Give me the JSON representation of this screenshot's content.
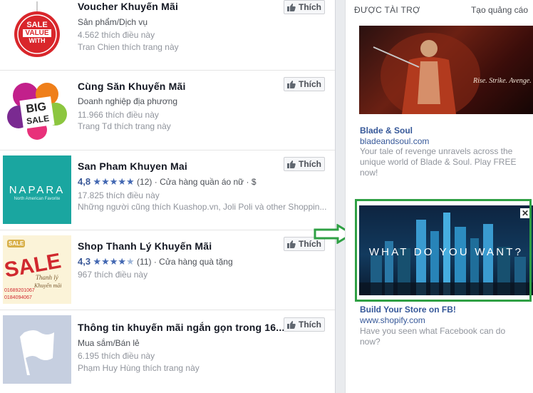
{
  "pages": [
    {
      "name": "Voucher Khuyến Mãi",
      "category": "Sản phẩm/Dịch vụ",
      "likes": "4.562 thích điều này",
      "friends": "Tran Chien thích trang này",
      "like_label": "Thích",
      "thumb_text": [
        "SALE",
        "VALUE",
        "WITH"
      ]
    },
    {
      "name": "Cùng Săn Khuyến Mãi",
      "category": "Doanh nghiệp địa phương",
      "likes": "11.966 thích điều này",
      "friends": "Trang Td thích trang này",
      "like_label": "Thích",
      "thumb_text": [
        "BIG",
        "SALE"
      ]
    },
    {
      "name": "San Pham Khuyen Mai",
      "rating": "4,8",
      "stars": "★★★★★",
      "reviews": "(12)",
      "category": "· Cửa hàng quần áo nữ · $",
      "likes": "17.825 thích điều này",
      "friends": "Những người cũng thích Kuashop.vn, Joli Poli và other Shoppin...",
      "like_label": "Thích",
      "thumb_text": [
        "NAPARA",
        "North American Favorite"
      ]
    },
    {
      "name": "Shop Thanh Lý Khuyến Mãi",
      "rating": "4,3",
      "stars": "★★★★",
      "stars_half": "★",
      "reviews": "(11)",
      "category": "· Cửa hàng quà tặng",
      "likes": "967 thích điều này",
      "like_label": "Thích",
      "thumb_text": [
        "SALE",
        "SALE",
        "Thanh lý",
        "Khuyến mãi",
        "01689201067",
        "0184094067"
      ]
    },
    {
      "name": "Thông tin khuyến mãi ngắn gọn trong 16...",
      "category": "Mua sắm/Bán lẻ",
      "likes": "6.195 thích điều này",
      "friends": "Phạm Huy Hùng thích trang này",
      "like_label": "Thích"
    }
  ],
  "sidebar": {
    "sponsored": "ĐƯỢC TÀI TRỢ",
    "create_ad": "Tạo quảng cáo",
    "ads": [
      {
        "image_caption": "Rise. Strike. Avenge.",
        "title": "Blade & Soul",
        "domain": "bladeandsoul.com",
        "desc": "Your tale of revenge unravels across the unique world of Blade & Soul. Play FREE now!"
      },
      {
        "image_caption": "WHAT DO YOU WANT?",
        "close": "✕",
        "title": "Build Your Store on FB!",
        "domain": "www.shopify.com",
        "desc": "Have you seen what Facebook can do now?"
      }
    ]
  },
  "colors": {
    "highlight": "#2fa044",
    "link": "#365899",
    "star": "#4267b2"
  }
}
